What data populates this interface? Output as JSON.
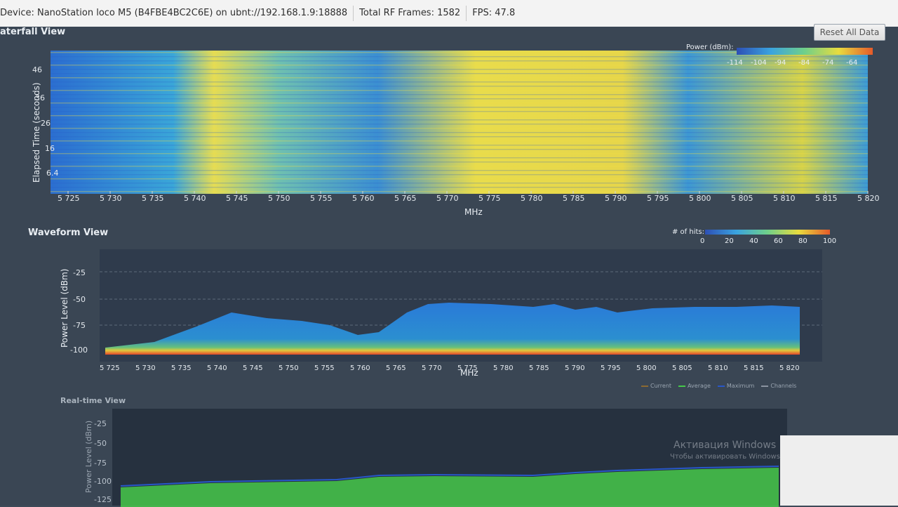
{
  "status_bar": {
    "device": "Device: NanoStation loco M5 (B4FBE4BC2C6E) on ubnt://192.168.1.9:18888",
    "rf_frames": "Total RF Frames: 1582",
    "fps": "FPS: 47.8"
  },
  "buttons": {
    "reset": "Reset All Data"
  },
  "waterfall": {
    "title": "aterfall View",
    "y_axis_title": "Elapsed Time (seconds)",
    "y_ticks": [
      "46",
      "36",
      "26",
      "16",
      "6.4"
    ],
    "x_axis_title": "MHz",
    "x_ticks": [
      "5 725",
      "5 730",
      "5 735",
      "5 740",
      "5 745",
      "5 750",
      "5 755",
      "5 760",
      "5 765",
      "5 770",
      "5 775",
      "5 780",
      "5 785",
      "5 790",
      "5 795",
      "5 800",
      "5 805",
      "5 810",
      "5 815",
      "5 820"
    ],
    "legend_title": "Power (dBm):",
    "legend_ticks": [
      "-114",
      "-104",
      "-94",
      "-84",
      "-74",
      "-64"
    ]
  },
  "waveform": {
    "title": "Waveform View",
    "y_axis_title": "Power Level (dBm)",
    "y_ticks": [
      "-25",
      "-50",
      "-75",
      "-100"
    ],
    "x_axis_title": "MHz",
    "x_ticks": [
      "5 725",
      "5 730",
      "5 735",
      "5 740",
      "5 745",
      "5 750",
      "5 755",
      "5 760",
      "5 765",
      "5 770",
      "5 775",
      "5 780",
      "5 785",
      "5 790",
      "5 795",
      "5 800",
      "5 805",
      "5 810",
      "5 815",
      "5 820"
    ],
    "legend_title": "# of hits:",
    "legend_ticks": [
      "0",
      "20",
      "40",
      "60",
      "80",
      "100"
    ],
    "series_legend": [
      "Current",
      "Average",
      "Maximum",
      "Channels"
    ]
  },
  "realtime": {
    "title": "Real-time View",
    "y_axis_title": "Power Level (dBm)",
    "y_ticks": [
      "-25",
      "-50",
      "-75",
      "-100",
      "-125"
    ]
  },
  "watermark": {
    "line1": "Активация Windows",
    "line2": "Чтобы активировать Windows"
  },
  "colors": {
    "chart_bg": "#2f3b4c",
    "waterfall_low": "#2a6fd6",
    "waterfall_high": "#f0e040",
    "noise_floor": "#e8402a",
    "average_series": "#46c84a",
    "maximum_series": "#2857c8"
  }
}
